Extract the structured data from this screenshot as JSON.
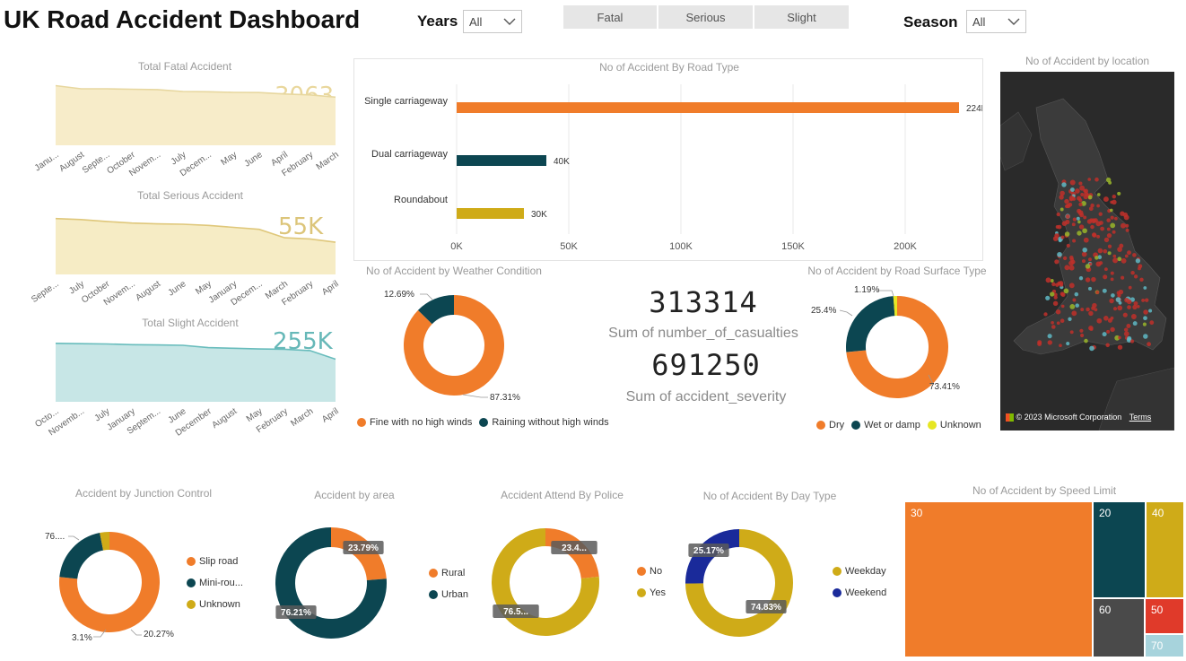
{
  "dashboard": {
    "title": "UK Road Accident Dashboard",
    "years_label": "Years",
    "years_value": "All",
    "season_label": "Season",
    "season_value": "All",
    "severity_buttons": [
      "Fatal",
      "Serious",
      "Slight"
    ]
  },
  "colors": {
    "orange": "#f07c2a",
    "teal": "#0c4651",
    "gold": "#cfab18",
    "navy": "#1a2a9a",
    "cream_fill": "#f7ecc9",
    "cream_line": "#e7d79f",
    "gold_fill": "#f6ecc5",
    "gold_line": "#dfc77a",
    "cyan_fill": "#c7e6e6",
    "cyan_line": "#68bcbc"
  },
  "kpis": {
    "casualties_value": "313314",
    "casualties_label": "Sum of number_of_casualties",
    "severity_value": "691250",
    "severity_label": "Sum of accident_severity"
  },
  "map": {
    "title": "No of Accident by location",
    "attribution": "© 2023 Microsoft Corporation",
    "terms": "Terms",
    "logo_text": "Microsoft Bing"
  },
  "chart_data": [
    {
      "id": "fatal",
      "type": "area",
      "title": "Total Fatal Accident",
      "card_value": "3063",
      "categories": [
        "Janu...",
        "August",
        "Septe...",
        "October",
        "Novem...",
        "July",
        "Decem...",
        "May",
        "June",
        "April",
        "February",
        "March"
      ],
      "values": [
        285,
        270,
        270,
        268,
        266,
        257,
        256,
        253,
        252,
        245,
        241,
        230
      ],
      "ylim": [
        0,
        300
      ]
    },
    {
      "id": "serious",
      "type": "area",
      "title": "Total Serious Accident",
      "card_value": "55K",
      "categories": [
        "Septe...",
        "July",
        "October",
        "Novem...",
        "August",
        "June",
        "May",
        "January",
        "Decem...",
        "March",
        "February",
        "April"
      ],
      "values": [
        4850,
        4800,
        4700,
        4620,
        4580,
        4560,
        4500,
        4400,
        4300,
        3870,
        3810,
        3640
      ],
      "ylim": [
        2000,
        5200
      ]
    },
    {
      "id": "slight",
      "type": "area",
      "title": "Total Slight Accident",
      "card_value": "255K",
      "categories": [
        "Octo...",
        "Novemb...",
        "July",
        "January",
        "Septem...",
        "June",
        "December",
        "August",
        "May",
        "February",
        "March",
        "April"
      ],
      "values": [
        22700,
        22600,
        22500,
        22300,
        22200,
        22100,
        21400,
        21200,
        21000,
        20900,
        20500,
        17900
      ],
      "ylim": [
        5000,
        24000
      ]
    },
    {
      "id": "road_type",
      "type": "bar",
      "title": "No of Accident By Road Type",
      "categories": [
        "Single carriageway",
        "Dual carriageway",
        "Roundabout"
      ],
      "values": [
        224000,
        40000,
        30000
      ],
      "data_labels": [
        "224K",
        "40K",
        "30K"
      ],
      "colors": [
        "#f07c2a",
        "#0c4651",
        "#cfab18"
      ],
      "xlim": [
        0,
        240000
      ],
      "xticks": [
        "0K",
        "50K",
        "100K",
        "150K",
        "200K"
      ]
    },
    {
      "id": "weather",
      "type": "pie",
      "title": "No of Accident by Weather Condition",
      "labels": [
        "Fine with no high winds",
        "Raining without high winds"
      ],
      "values": [
        87.31,
        12.69
      ],
      "data_labels": [
        "87.31%",
        "12.69%"
      ],
      "colors": [
        "#f07c2a",
        "#0c4651"
      ]
    },
    {
      "id": "surface",
      "type": "pie",
      "title": "No of Accident by Road Surface Type",
      "labels": [
        "Dry",
        "Wet or damp",
        "Unknown"
      ],
      "values": [
        73.41,
        25.4,
        1.19
      ],
      "data_labels": [
        "73.41%",
        "25.4%",
        "1.19%"
      ],
      "colors": [
        "#f07c2a",
        "#0c4651",
        "#e6e622"
      ]
    },
    {
      "id": "junction",
      "type": "pie",
      "title": "Accident by Junction Control",
      "labels": [
        "Slip road",
        "Mini-rou...",
        "Unknown"
      ],
      "values": [
        76.63,
        20.27,
        3.1
      ],
      "data_labels": [
        "76....",
        "20.27%",
        "3.1%"
      ],
      "colors": [
        "#f07c2a",
        "#0c4651",
        "#cfab18"
      ]
    },
    {
      "id": "area",
      "type": "pie",
      "title": "Accident by area",
      "labels": [
        "Rural",
        "Urban"
      ],
      "values": [
        23.79,
        76.21
      ],
      "data_labels": [
        "23.79%",
        "76.21%"
      ],
      "colors": [
        "#f07c2a",
        "#0c4651"
      ]
    },
    {
      "id": "police",
      "type": "pie",
      "title": "Accident Attend By Police",
      "labels": [
        "No",
        "Yes"
      ],
      "values": [
        23.4,
        76.6
      ],
      "data_labels": [
        "23.4...",
        "76.5..."
      ],
      "colors": [
        "#f07c2a",
        "#cfab18"
      ]
    },
    {
      "id": "daytype",
      "type": "pie",
      "title": "No of Accident By  Day Type",
      "labels": [
        "Weekday",
        "Weekend"
      ],
      "values": [
        74.83,
        25.17
      ],
      "data_labels": [
        "74.83%",
        "25.17%"
      ],
      "colors": [
        "#cfab18",
        "#1a2a9a"
      ]
    },
    {
      "id": "speed",
      "type": "treemap",
      "title": "No of Accident by Speed Limit",
      "labels": [
        "30",
        "20",
        "40",
        "60",
        "50",
        "70"
      ],
      "colors": [
        "#f07c2a",
        "#0c4651",
        "#cfab18",
        "#4a4a4a",
        "#e03a2a",
        "#a7d3dc"
      ]
    }
  ]
}
